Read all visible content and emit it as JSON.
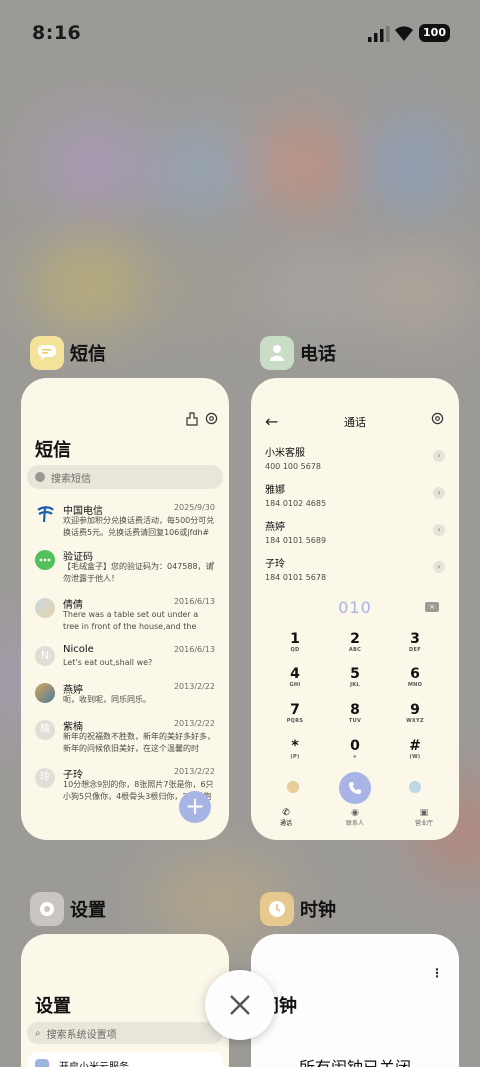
{
  "status_bar": {
    "time": "8:16",
    "battery": "100"
  },
  "apps": {
    "sms": {
      "name": "短信",
      "title": "短信",
      "search_placeholder": "搜索短信",
      "messages": [
        {
          "name": "中国电信",
          "date": "2025/9/30",
          "preview": "欢迎参加积分兑换话费活动，每500分可兑换话费5元。兑换话费请回复106或jfdh#话费..."
        },
        {
          "name": "验证码",
          "date": "",
          "preview": "【毛绒盒子】您的验证码为：047588，请勿泄露于他人！"
        },
        {
          "name": "倩倩",
          "date": "2016/6/13",
          "preview": "There was a table set out under a tree in front of the house,and the March Hare an..."
        },
        {
          "name": "Nicole",
          "date": "2016/6/13",
          "preview": "Let's eat out,shall we?",
          "avatar_letter": "N"
        },
        {
          "name": "燕婷",
          "date": "2013/2/22",
          "preview": "呃，收到呢，同乐同乐。"
        },
        {
          "name": "紫楠",
          "date": "2013/2/22",
          "preview": "新年的祝福数不胜数，新年的美好多好多，新年的问候依旧美好，在这个温馨的时刻，...",
          "avatar_letter": "楠"
        },
        {
          "name": "子玲",
          "date": "2013/2/22",
          "preview": "10分想念9別的你，8张照片7张是你，6只小狗5只像你，4根骨头3根归你，2爪着抱住...",
          "avatar_letter": "玲"
        }
      ]
    },
    "phone": {
      "name": "电话",
      "title": "通话",
      "contacts": [
        {
          "name": "小米客服",
          "number": "400 100 5678"
        },
        {
          "name": "雅娜",
          "number": "184 0102 4685"
        },
        {
          "name": "燕婷",
          "number": "184 0101 5689"
        },
        {
          "name": "子玲",
          "number": "184 0101 5678"
        }
      ],
      "dial_input": "010",
      "keys": [
        {
          "d": "1",
          "l": "QD"
        },
        {
          "d": "2",
          "l": "ABC"
        },
        {
          "d": "3",
          "l": "DEF"
        },
        {
          "d": "4",
          "l": "GHI"
        },
        {
          "d": "5",
          "l": "JKL"
        },
        {
          "d": "6",
          "l": "MNO"
        },
        {
          "d": "7",
          "l": "PQRS"
        },
        {
          "d": "8",
          "l": "TUV"
        },
        {
          "d": "9",
          "l": "WXYZ"
        },
        {
          "d": "*",
          "l": "(P)"
        },
        {
          "d": "0",
          "l": "+"
        },
        {
          "d": "#",
          "l": "(W)"
        }
      ],
      "tabs": {
        "calls": "通话",
        "contacts": "联系人",
        "yellow_pages": "营业厅"
      }
    },
    "settings": {
      "name": "设置",
      "title": "设置",
      "search_placeholder": "搜索系统设置项",
      "first_item": "开启小米云服务"
    },
    "clock": {
      "name": "时钟",
      "title": "闹钟",
      "empty_text": "所有闹钟已关闭"
    }
  },
  "colors": {
    "card_bg": "#fbf7e9",
    "accent_blue": "#a9b4e6",
    "sms_icon": "#f3e39a",
    "phone_icon": "#c9dcc6",
    "settings_icon": "#c9c6c2",
    "clock_icon": "#e6c98e"
  }
}
